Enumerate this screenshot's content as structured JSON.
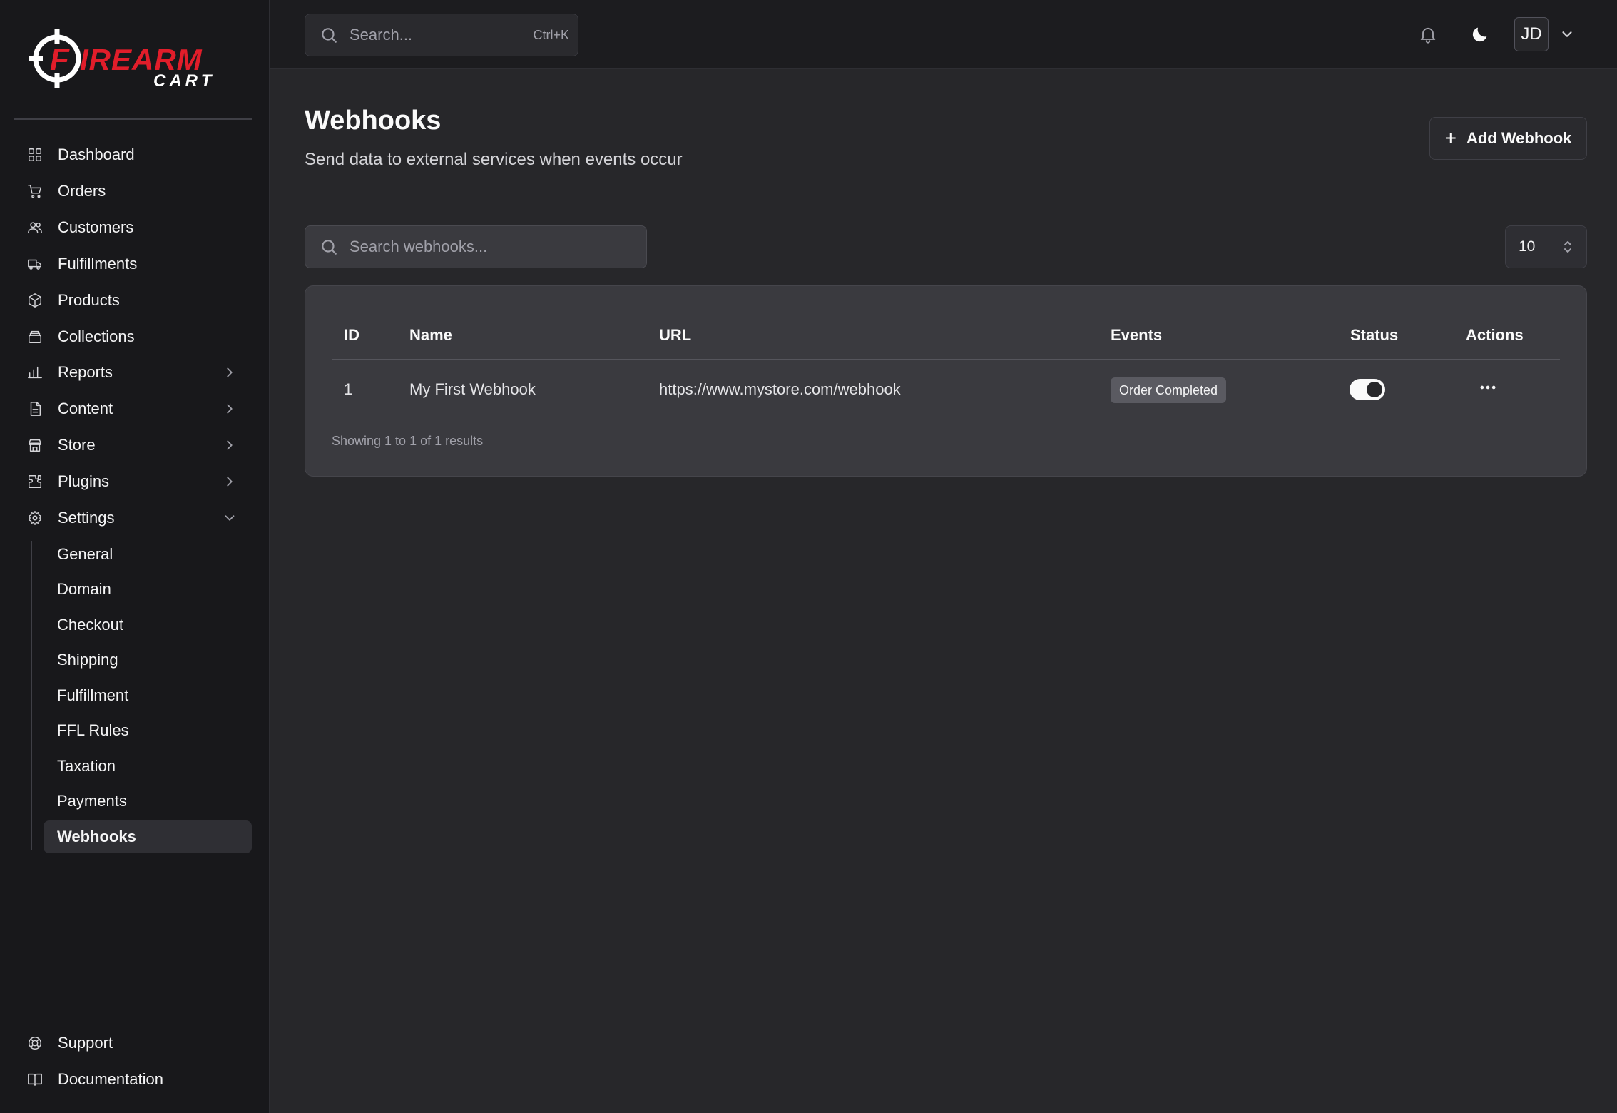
{
  "brand": {
    "logo_word1": "FIREARM",
    "logo_word2": "CART",
    "accent": "#e11d2a"
  },
  "sidebar": {
    "items": [
      {
        "label": "Dashboard",
        "icon": "dashboard-icon"
      },
      {
        "label": "Orders",
        "icon": "cart-icon"
      },
      {
        "label": "Customers",
        "icon": "users-icon"
      },
      {
        "label": "Fulfillments",
        "icon": "truck-icon"
      },
      {
        "label": "Products",
        "icon": "box-icon"
      },
      {
        "label": "Collections",
        "icon": "collections-icon"
      },
      {
        "label": "Reports",
        "icon": "bar-chart-icon"
      },
      {
        "label": "Content",
        "icon": "file-icon"
      },
      {
        "label": "Store",
        "icon": "store-icon"
      },
      {
        "label": "Plugins",
        "icon": "puzzle-icon"
      },
      {
        "label": "Settings",
        "icon": "gear-icon"
      }
    ],
    "settings_sub": [
      "General",
      "Domain",
      "Checkout",
      "Shipping",
      "Fulfillment",
      "FFL Rules",
      "Taxation",
      "Payments",
      "Webhooks"
    ],
    "active_sub": "Webhooks",
    "footer": [
      {
        "label": "Support",
        "icon": "lifebuoy-icon"
      },
      {
        "label": "Documentation",
        "icon": "book-icon"
      }
    ]
  },
  "topbar": {
    "search_placeholder": "Search...",
    "search_shortcut": "Ctrl+K",
    "avatar_initials": "JD"
  },
  "page": {
    "title": "Webhooks",
    "subtitle": "Send data to external services when events occur",
    "add_button": "Add Webhook",
    "search_placeholder": "Search webhooks...",
    "per_page": "10"
  },
  "table": {
    "headers": {
      "id": "ID",
      "name": "Name",
      "url": "URL",
      "events": "Events",
      "status": "Status",
      "actions": "Actions"
    },
    "rows": [
      {
        "id": "1",
        "name": "My First Webhook",
        "url": "https://www.mystore.com/webhook",
        "event": "Order Completed",
        "enabled": true
      }
    ],
    "summary": "Showing 1 to 1 of 1 results"
  }
}
